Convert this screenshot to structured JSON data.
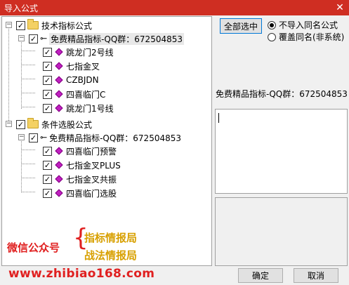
{
  "window": {
    "title": "导入公式",
    "close_glyph": "✕"
  },
  "tree": {
    "groups": [
      {
        "label": "技术指标公式",
        "checked": "✓",
        "author": {
          "label": "免费精品指标-QQ群：672504853",
          "checked": "✓"
        },
        "items": [
          {
            "label": "跳龙门2号线",
            "checked": "✓"
          },
          {
            "label": "七指金叉",
            "checked": "✓"
          },
          {
            "label": "CZBJDN",
            "checked": "✓"
          },
          {
            "label": "四喜临门C",
            "checked": "✓"
          },
          {
            "label": "跳龙门1号线",
            "checked": "✓"
          }
        ]
      },
      {
        "label": "条件选股公式",
        "checked": "✓",
        "author": {
          "label": "免费精品指标-QQ群：672504853",
          "checked": "✓"
        },
        "items": [
          {
            "label": "四喜临门预警",
            "checked": "✓"
          },
          {
            "label": "七指金叉PLUS",
            "checked": "✓"
          },
          {
            "label": "七指金叉共振",
            "checked": "✓"
          },
          {
            "label": "四喜临门选股",
            "checked": "✓"
          }
        ]
      }
    ],
    "expander_open": "−"
  },
  "watermark": {
    "label": "微信公众号",
    "brace": "{",
    "line1": "指标情报局",
    "line2": "战法情报局",
    "site": "www.zhibiao168.com",
    "red": "#e02020",
    "gold": "#d8a000"
  },
  "actions": {
    "select_all": "全部选中",
    "ok": "确定",
    "cancel": "取消"
  },
  "options": {
    "no_import_same_name": "不导入同名公式",
    "overwrite_same_name": "覆盖同名(非系统)",
    "selected": "no_import_same_name"
  },
  "detail": {
    "name": "免费精品指标-QQ群：672504853",
    "text_value": ""
  },
  "colors": {
    "title_bar": "#cf2e22",
    "item_icon": "#c020c0"
  }
}
